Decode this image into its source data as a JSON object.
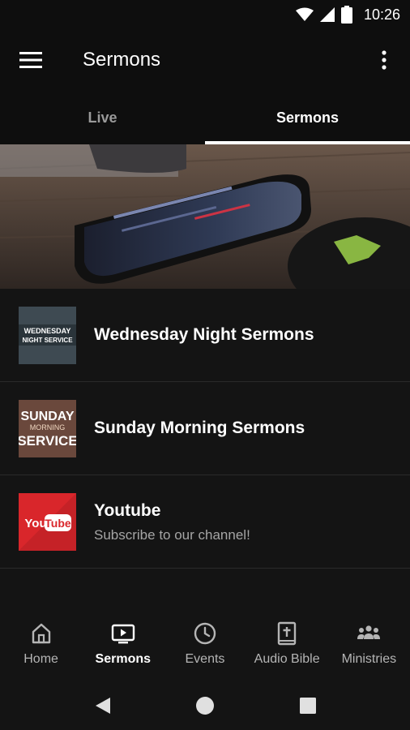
{
  "status_bar": {
    "time": "10:26",
    "icons": [
      "wifi-icon",
      "signal-icon",
      "battery-icon"
    ]
  },
  "app_bar": {
    "title": "Sermons",
    "menu_icon": "menu-icon",
    "more_icon": "more-vert-icon"
  },
  "tabs": [
    {
      "label": "Live",
      "active": false
    },
    {
      "label": "Sermons",
      "active": true
    }
  ],
  "hero": {
    "image": "phone-on-table-photo"
  },
  "list": [
    {
      "title": "Wednesday Night Sermons",
      "subtitle": "",
      "thumb": {
        "lines": [
          "WEDNESDAY",
          "NIGHT SERVICE"
        ]
      }
    },
    {
      "title": "Sunday Morning Sermons",
      "subtitle": "",
      "thumb": {
        "lines": [
          "SUNDAY",
          "MORNING",
          "SERVICE"
        ]
      }
    },
    {
      "title": "Youtube",
      "subtitle": "Subscribe to our channel!",
      "thumb": {
        "lines": [
          "You",
          "Tube"
        ]
      }
    }
  ],
  "bottom_nav": [
    {
      "label": "Home",
      "icon": "home-icon",
      "active": false
    },
    {
      "label": "Sermons",
      "icon": "tv-icon",
      "active": true
    },
    {
      "label": "Events",
      "icon": "clock-icon",
      "active": false
    },
    {
      "label": "Audio Bible",
      "icon": "bible-icon",
      "active": false
    },
    {
      "label": "Ministries",
      "icon": "people-icon",
      "active": false
    }
  ],
  "colors": {
    "background": "#141414",
    "bar": "#0e0e0e",
    "youtube_red": "#d9262b",
    "divider": "#2a2a2a"
  }
}
